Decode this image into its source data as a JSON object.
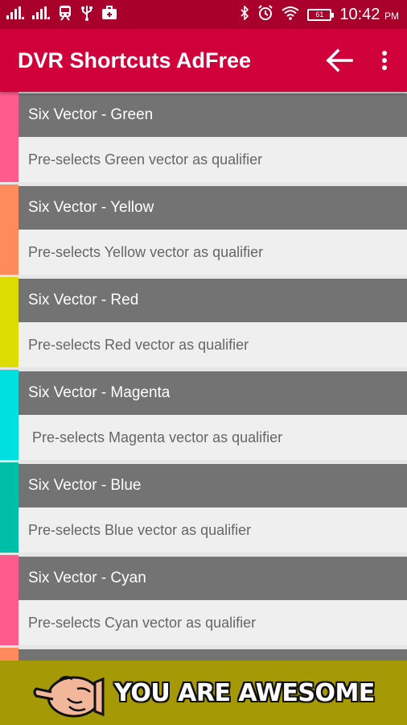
{
  "status_bar": {
    "time": "10:42",
    "ampm": "PM",
    "battery_level": "61",
    "icons": [
      "signal-icon",
      "signal-icon",
      "train-icon",
      "usb-icon",
      "briefcase-icon",
      "bluetooth-icon",
      "alarm-icon",
      "wifi-icon",
      "battery-icon"
    ]
  },
  "app_bar": {
    "title": "DVR Shortcuts AdFree",
    "back_icon": "arrow-left-icon",
    "menu_icon": "more-vert-icon"
  },
  "colors": {
    "status_bar": "#a8002a",
    "app_bar": "#d0003a",
    "title_row": "#737373",
    "desc_row": "#efefef",
    "banner": "#a59a05"
  },
  "items": [
    {
      "title": "Six Vector - Green",
      "description": "Pre-selects Green vector as qualifier",
      "stripe": "#ff5c8d"
    },
    {
      "title": "Six Vector - Yellow",
      "description": "Pre-selects Yellow vector as qualifier",
      "stripe": "#ff8a5c"
    },
    {
      "title": "Six Vector - Red",
      "description": "Pre-selects Red vector as qualifier",
      "stripe": "#dcdc00"
    },
    {
      "title": "Six Vector - Magenta",
      "description": "Pre-selects Magenta vector as qualifier",
      "stripe": "#00e0e0"
    },
    {
      "title": "Six Vector - Blue",
      "description": "Pre-selects Blue vector as qualifier",
      "stripe": "#00bfa8"
    },
    {
      "title": "Six Vector - Cyan",
      "description": "Pre-selects Cyan vector as qualifier",
      "stripe": "#ff5c8d"
    },
    {
      "title": "",
      "description": "",
      "stripe": "#ff8a5c"
    }
  ],
  "banner": {
    "text": "YOU ARE AWESOME",
    "icon": "pointing-hand-icon"
  }
}
